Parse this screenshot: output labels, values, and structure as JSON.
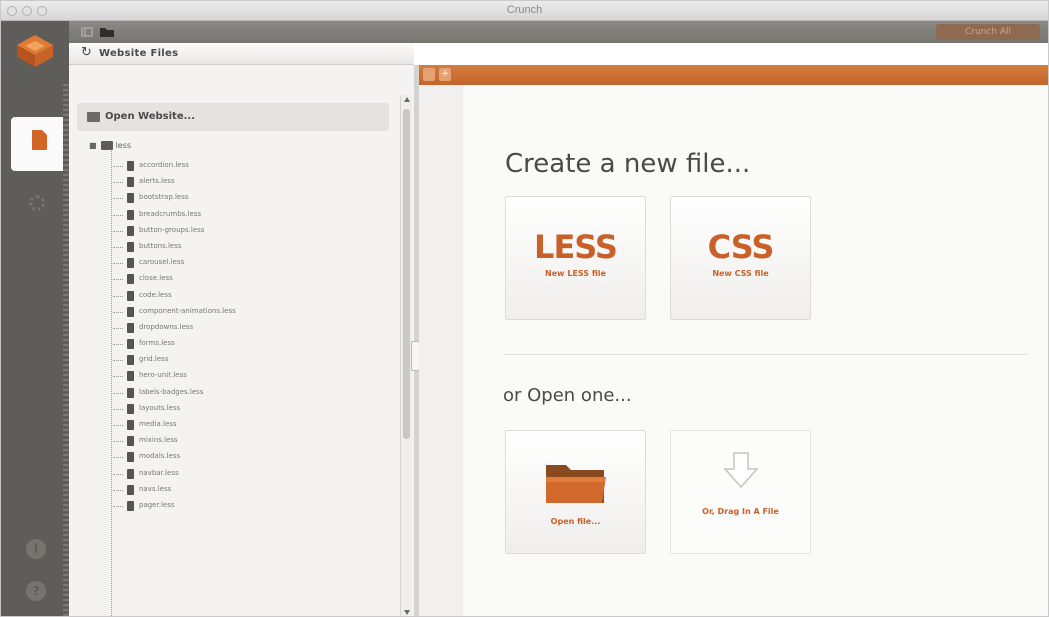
{
  "window": {
    "title": "Crunch"
  },
  "toolbar": {
    "top_right_button": "Crunch All"
  },
  "file_panel": {
    "header": "Website Files",
    "open_website": "Open Website...",
    "root_folder": "less",
    "files": [
      "accordion.less",
      "alerts.less",
      "bootstrap.less",
      "breadcrumbs.less",
      "button-groups.less",
      "buttons.less",
      "carousel.less",
      "close.less",
      "code.less",
      "component-animations.less",
      "dropdowns.less",
      "forms.less",
      "grid.less",
      "hero-unit.less",
      "labels-badges.less",
      "layouts.less",
      "media.less",
      "mixins.less",
      "modals.less",
      "navbar.less",
      "navs.less",
      "pager.less"
    ]
  },
  "tabbar": {
    "add_label": "+"
  },
  "main": {
    "create_heading": "Create a new file...",
    "open_heading": "or Open one...",
    "new_less": {
      "big": "LESS",
      "label": "New LESS file"
    },
    "new_css": {
      "big": "CSS",
      "label": "New CSS file"
    },
    "open_file": {
      "label": "Open file..."
    },
    "drag_file": {
      "label": "Or, Drag In A File"
    }
  },
  "colors": {
    "accent": "#c9602a",
    "tab_bar": "#cb6f33",
    "sidebar": "#5e5d59"
  }
}
